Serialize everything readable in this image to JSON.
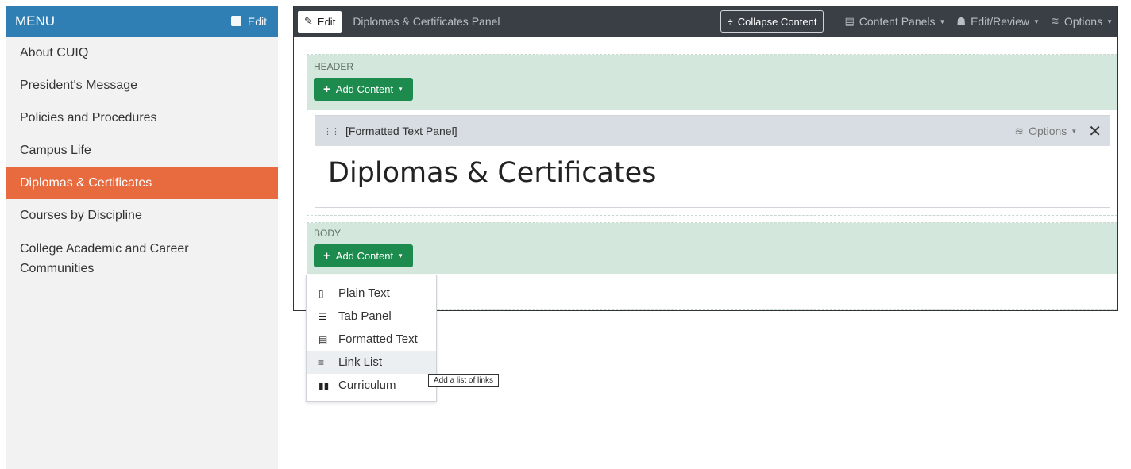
{
  "sidebar": {
    "title": "MENU",
    "edit_label": "Edit",
    "items": [
      {
        "label": "About CUIQ"
      },
      {
        "label": "President's Message"
      },
      {
        "label": "Policies and Procedures"
      },
      {
        "label": "Campus Life"
      },
      {
        "label": "Diplomas & Certificates",
        "active": true
      },
      {
        "label": "Courses by Discipline"
      },
      {
        "label": "College Academic and Career Communities"
      }
    ]
  },
  "toolbar": {
    "edit_label": "Edit",
    "panel_title": "Diplomas & Certificates Panel",
    "collapse_label": "Collapse Content",
    "content_panels_label": "Content Panels",
    "edit_review_label": "Edit/Review",
    "options_label": "Options"
  },
  "regions": {
    "header_label": "HEADER",
    "body_label": "BODY",
    "add_content_label": "Add Content"
  },
  "content_panel": {
    "label": "[Formatted Text Panel]",
    "options_label": "Options",
    "heading": "Diplomas & Certificates"
  },
  "dropdown": {
    "items": [
      {
        "label": "Plain Text",
        "icon": "file-text-icon"
      },
      {
        "label": "Tab Panel",
        "icon": "table-list-icon"
      },
      {
        "label": "Formatted Text",
        "icon": "formatted-file-icon"
      },
      {
        "label": "Link List",
        "icon": "list-icon"
      },
      {
        "label": "Curriculum",
        "icon": "book-icon"
      }
    ]
  },
  "tooltip": "Add a list of links",
  "colors": {
    "menu_header": "#2f7fb5",
    "active_item": "#e86b3f",
    "toolbar": "#3a3f46",
    "region_band": "#d4e7dc",
    "add_button": "#1d8a4e"
  }
}
